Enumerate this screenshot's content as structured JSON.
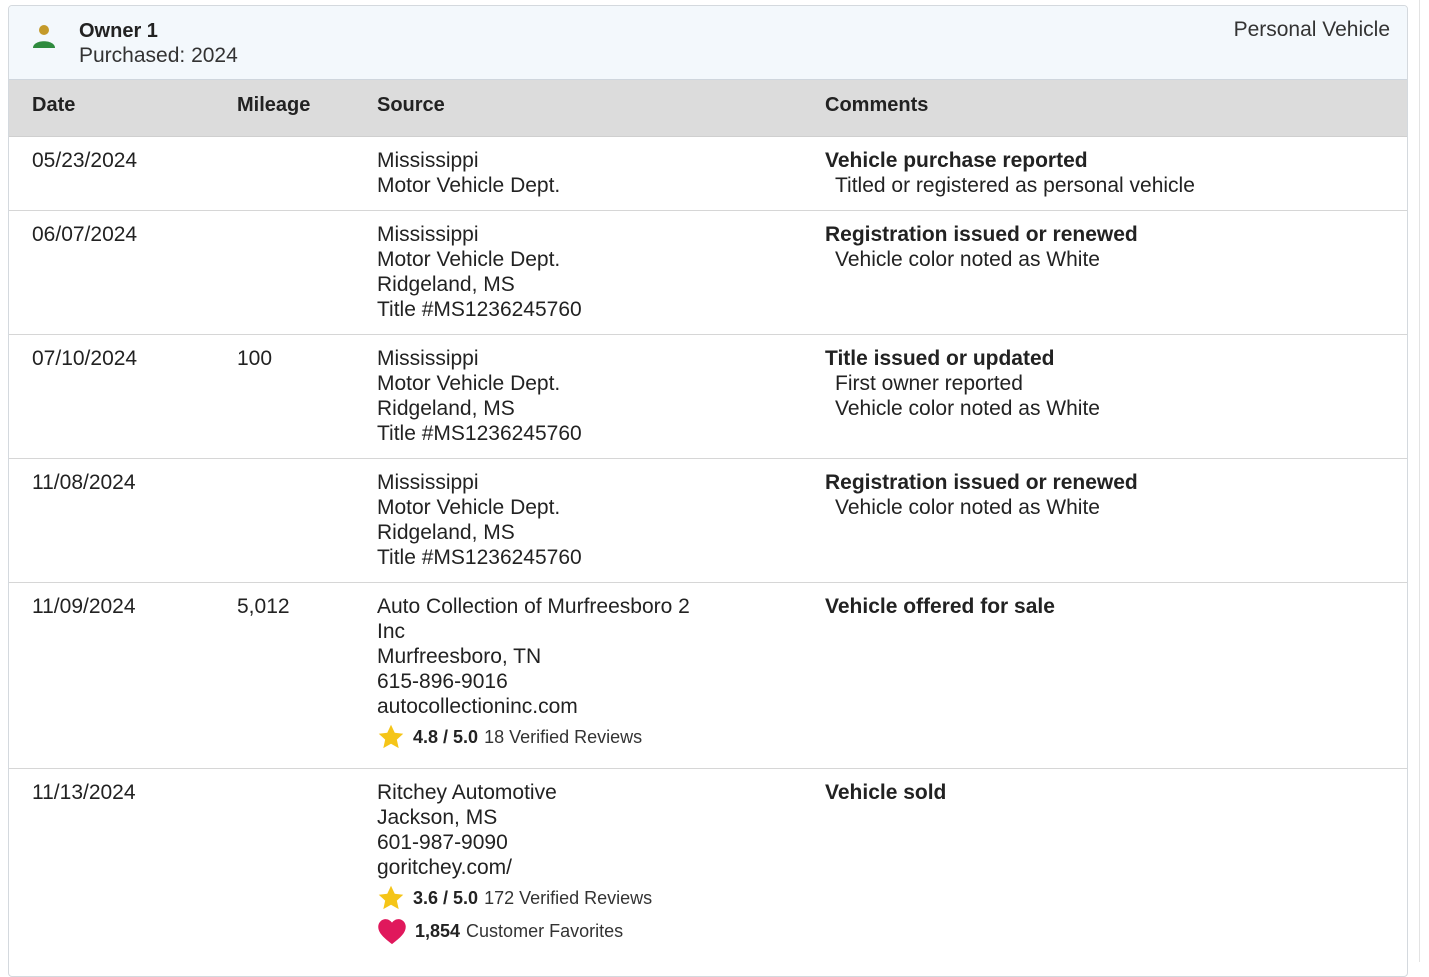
{
  "owner": {
    "title": "Owner 1",
    "purchased": "Purchased: 2024",
    "type": "Personal Vehicle"
  },
  "columns": {
    "date": "Date",
    "mileage": "Mileage",
    "source": "Source",
    "comments": "Comments"
  },
  "rows": [
    {
      "date": "05/23/2024",
      "mileage": "",
      "source": [
        "Mississippi",
        "Motor Vehicle Dept."
      ],
      "comment_title": "Vehicle purchase reported",
      "comment_lines": [
        "Titled or registered as personal vehicle"
      ]
    },
    {
      "date": "06/07/2024",
      "mileage": "",
      "source": [
        "Mississippi",
        "Motor Vehicle Dept.",
        "Ridgeland, MS",
        "Title #MS1236245760"
      ],
      "comment_title": "Registration issued or renewed",
      "comment_lines": [
        "Vehicle color noted as White"
      ]
    },
    {
      "date": "07/10/2024",
      "mileage": "100",
      "source": [
        "Mississippi",
        "Motor Vehicle Dept.",
        "Ridgeland, MS",
        "Title #MS1236245760"
      ],
      "comment_title": "Title issued or updated",
      "comment_lines": [
        "First owner reported",
        "Vehicle color noted as White"
      ]
    },
    {
      "date": "11/08/2024",
      "mileage": "",
      "source": [
        "Mississippi",
        "Motor Vehicle Dept.",
        "Ridgeland, MS",
        "Title #MS1236245760"
      ],
      "comment_title": "Registration issued or renewed",
      "comment_lines": [
        "Vehicle color noted as White"
      ]
    },
    {
      "date": "11/09/2024",
      "mileage": "5,012",
      "source": [
        "Auto Collection of Murfreesboro 2",
        "Inc",
        "Murfreesboro, TN",
        "615-896-9016",
        "autocollectioninc.com"
      ],
      "rating": {
        "score": "4.8 / 5.0",
        "text": "18 Verified Reviews",
        "icon": "star-icon"
      },
      "comment_title": "Vehicle offered for sale",
      "comment_lines": []
    },
    {
      "date": "11/13/2024",
      "mileage": "",
      "source": [
        "Ritchey Automotive",
        "Jackson, MS",
        "601-987-9090",
        "goritchey.com/"
      ],
      "rating": {
        "score": "3.6 / 5.0",
        "text": "172 Verified Reviews",
        "icon": "star-icon"
      },
      "favorites": {
        "count": "1,854",
        "text": "Customer Favorites",
        "icon": "heart-icon"
      },
      "comment_title": "Vehicle sold",
      "comment_lines": []
    }
  ],
  "colors": {
    "header_bg": "#f3f8fc",
    "table_header_bg": "#dcdcdc",
    "person_icon": "#2e8b3e",
    "person_head": "#c49a2a",
    "star": "#f5c518",
    "heart": "#e0185c"
  }
}
